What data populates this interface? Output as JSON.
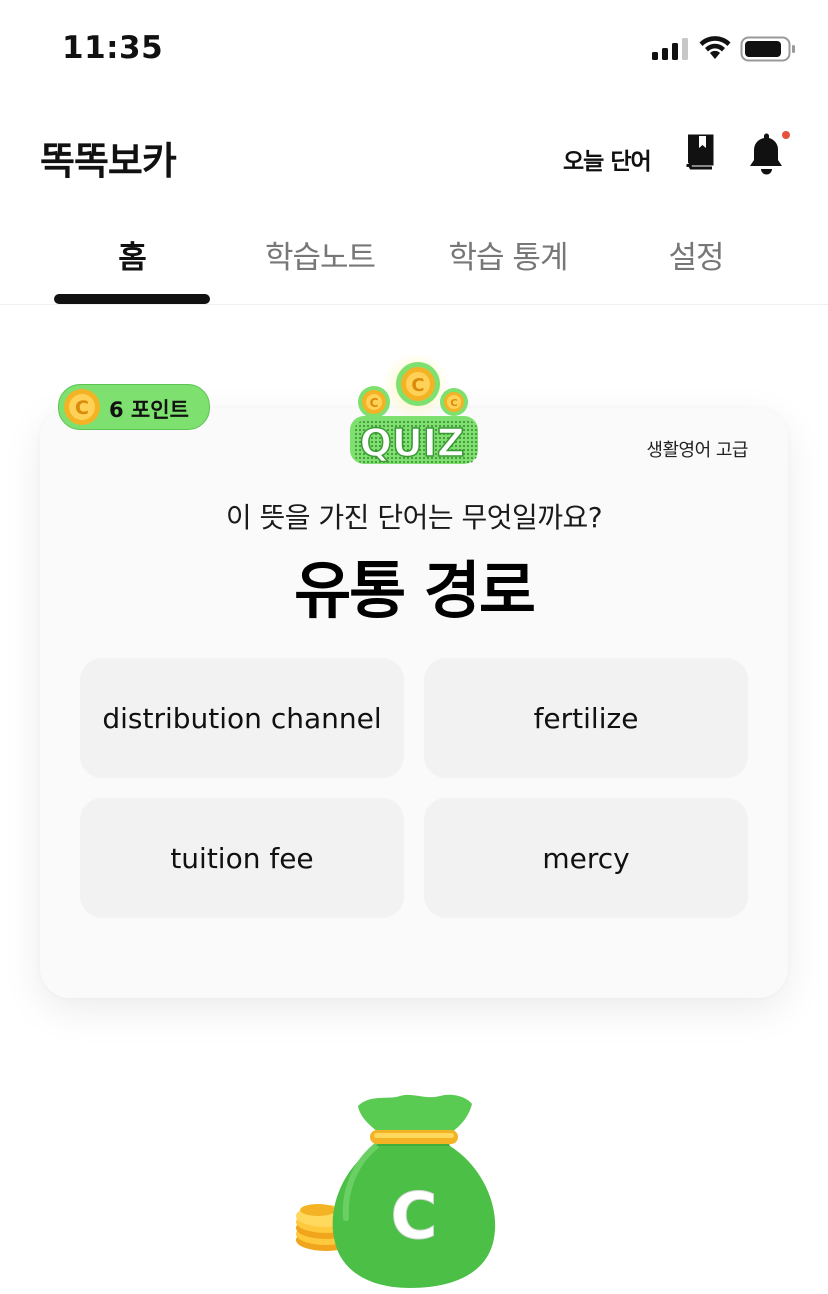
{
  "status_bar": {
    "time": "11:35"
  },
  "header": {
    "app_title": "똑똑보카",
    "today_word": "오늘 단어",
    "icons": [
      "book-icon",
      "bell-icon"
    ]
  },
  "tabs": [
    {
      "label": "홈",
      "active": true
    },
    {
      "label": "학습노트",
      "active": false
    },
    {
      "label": "학습 통계",
      "active": false
    },
    {
      "label": "설정",
      "active": false
    }
  ],
  "quiz": {
    "points": "6 포인트",
    "logo_text": "QUIZ",
    "level": "생활영어 고급",
    "question": "이 뜻을 가진 단어는 무엇일까요?",
    "meaning": "유통 경로",
    "options": [
      "distribution channel",
      "fertilize",
      "tuition fee",
      "mercy"
    ],
    "coin_letter": "C"
  },
  "colors": {
    "accent_green": "#7ee06e",
    "bag_green": "#4cbf47",
    "coin_gold": "#f4b324",
    "notification_dot": "#e5533d"
  }
}
